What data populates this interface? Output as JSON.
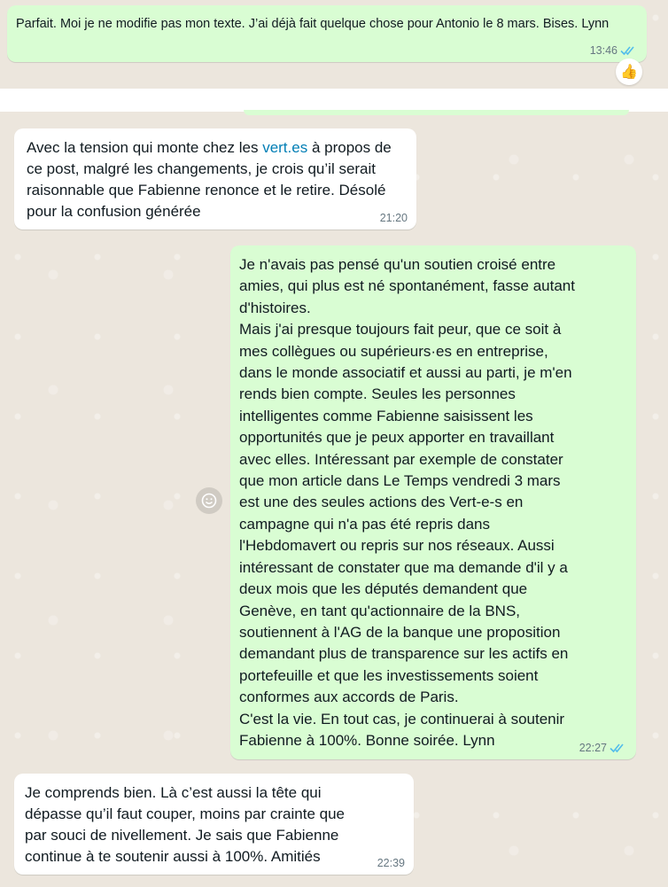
{
  "messages": [
    {
      "id": "msg1",
      "direction": "outgoing",
      "text": "Parfait. Moi je ne modifie pas mon texte. J’ai déjà fait quelque chose pour Antonio le 8 mars. Bises. Lynn",
      "time": "13:46",
      "status": "read",
      "reaction": "👍"
    },
    {
      "id": "msg2",
      "direction": "incoming",
      "text_before": "Avec la tension qui monte chez les ",
      "link": "vert.es",
      "text_after": " à propos de ce post, malgré les changements, je crois qu’il serait raisonnable que Fabienne renonce et le retire. Désolé pour la confusion générée",
      "time": "21:20"
    },
    {
      "id": "msg3",
      "direction": "outgoing",
      "text": "Je n'avais pas pensé qu'un soutien croisé entre\namies, qui plus est né spontanément, fasse autant\nd'histoires.\nMais j'ai presque toujours fait peur, que ce soit à\nmes collègues ou supérieurs·es en entreprise,\ndans le monde associatif et aussi au parti, je m'en\nrends bien compte. Seules les personnes\nintelligentes comme Fabienne saisissent les\nopportunités que je peux apporter en travaillant\navec elles. Intéressant par exemple de constater\nque mon article dans Le Temps vendredi 3 mars\nest une des seules actions des Vert-e-s en\ncampagne qui n'a pas été repris dans\nl'Hebdomavert ou repris sur nos réseaux. Aussi\nintéressant de constater que ma demande d'il y a\ndeux mois que les députés demandent que\nGenève, en tant qu'actionnaire de la BNS,\nsoutiennent à l'AG de la banque une proposition\ndemandant plus de transparence sur les actifs en\nportefeuille et que les investissements soient\nconformes aux accords de Paris.\nC'est la vie. En tout cas, je continuerai à soutenir\nFabienne à 100%. Bonne soirée. Lynn",
      "time": "22:27",
      "status": "read"
    },
    {
      "id": "msg4",
      "direction": "incoming",
      "text": "Je comprends bien. Là c’est aussi  la tête qui\ndépasse qu’il faut couper, moins par crainte que\npar souci de nivellement. Je sais que Fabienne\ncontinue à te soutenir aussi à 100%. Amitiés",
      "time": "22:39"
    }
  ],
  "icons": {
    "read_ticks": "double-check-icon",
    "reaction_emoji": "smiley-icon"
  },
  "colors": {
    "outgoing_bubble": "#d9fdd3",
    "incoming_bubble": "#ffffff",
    "link": "#027eb5",
    "read_ticks": "#53bdeb",
    "meta_text": "#667781"
  }
}
